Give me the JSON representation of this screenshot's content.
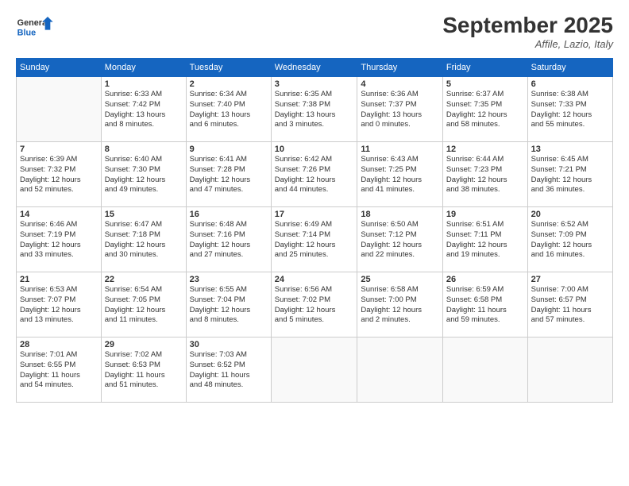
{
  "header": {
    "logo_line1": "General",
    "logo_line2": "Blue",
    "month": "September 2025",
    "location": "Affile, Lazio, Italy"
  },
  "weekdays": [
    "Sunday",
    "Monday",
    "Tuesday",
    "Wednesday",
    "Thursday",
    "Friday",
    "Saturday"
  ],
  "weeks": [
    [
      {
        "day": "",
        "info": ""
      },
      {
        "day": "1",
        "info": "Sunrise: 6:33 AM\nSunset: 7:42 PM\nDaylight: 13 hours\nand 8 minutes."
      },
      {
        "day": "2",
        "info": "Sunrise: 6:34 AM\nSunset: 7:40 PM\nDaylight: 13 hours\nand 6 minutes."
      },
      {
        "day": "3",
        "info": "Sunrise: 6:35 AM\nSunset: 7:38 PM\nDaylight: 13 hours\nand 3 minutes."
      },
      {
        "day": "4",
        "info": "Sunrise: 6:36 AM\nSunset: 7:37 PM\nDaylight: 13 hours\nand 0 minutes."
      },
      {
        "day": "5",
        "info": "Sunrise: 6:37 AM\nSunset: 7:35 PM\nDaylight: 12 hours\nand 58 minutes."
      },
      {
        "day": "6",
        "info": "Sunrise: 6:38 AM\nSunset: 7:33 PM\nDaylight: 12 hours\nand 55 minutes."
      }
    ],
    [
      {
        "day": "7",
        "info": "Sunrise: 6:39 AM\nSunset: 7:32 PM\nDaylight: 12 hours\nand 52 minutes."
      },
      {
        "day": "8",
        "info": "Sunrise: 6:40 AM\nSunset: 7:30 PM\nDaylight: 12 hours\nand 49 minutes."
      },
      {
        "day": "9",
        "info": "Sunrise: 6:41 AM\nSunset: 7:28 PM\nDaylight: 12 hours\nand 47 minutes."
      },
      {
        "day": "10",
        "info": "Sunrise: 6:42 AM\nSunset: 7:26 PM\nDaylight: 12 hours\nand 44 minutes."
      },
      {
        "day": "11",
        "info": "Sunrise: 6:43 AM\nSunset: 7:25 PM\nDaylight: 12 hours\nand 41 minutes."
      },
      {
        "day": "12",
        "info": "Sunrise: 6:44 AM\nSunset: 7:23 PM\nDaylight: 12 hours\nand 38 minutes."
      },
      {
        "day": "13",
        "info": "Sunrise: 6:45 AM\nSunset: 7:21 PM\nDaylight: 12 hours\nand 36 minutes."
      }
    ],
    [
      {
        "day": "14",
        "info": "Sunrise: 6:46 AM\nSunset: 7:19 PM\nDaylight: 12 hours\nand 33 minutes."
      },
      {
        "day": "15",
        "info": "Sunrise: 6:47 AM\nSunset: 7:18 PM\nDaylight: 12 hours\nand 30 minutes."
      },
      {
        "day": "16",
        "info": "Sunrise: 6:48 AM\nSunset: 7:16 PM\nDaylight: 12 hours\nand 27 minutes."
      },
      {
        "day": "17",
        "info": "Sunrise: 6:49 AM\nSunset: 7:14 PM\nDaylight: 12 hours\nand 25 minutes."
      },
      {
        "day": "18",
        "info": "Sunrise: 6:50 AM\nSunset: 7:12 PM\nDaylight: 12 hours\nand 22 minutes."
      },
      {
        "day": "19",
        "info": "Sunrise: 6:51 AM\nSunset: 7:11 PM\nDaylight: 12 hours\nand 19 minutes."
      },
      {
        "day": "20",
        "info": "Sunrise: 6:52 AM\nSunset: 7:09 PM\nDaylight: 12 hours\nand 16 minutes."
      }
    ],
    [
      {
        "day": "21",
        "info": "Sunrise: 6:53 AM\nSunset: 7:07 PM\nDaylight: 12 hours\nand 13 minutes."
      },
      {
        "day": "22",
        "info": "Sunrise: 6:54 AM\nSunset: 7:05 PM\nDaylight: 12 hours\nand 11 minutes."
      },
      {
        "day": "23",
        "info": "Sunrise: 6:55 AM\nSunset: 7:04 PM\nDaylight: 12 hours\nand 8 minutes."
      },
      {
        "day": "24",
        "info": "Sunrise: 6:56 AM\nSunset: 7:02 PM\nDaylight: 12 hours\nand 5 minutes."
      },
      {
        "day": "25",
        "info": "Sunrise: 6:58 AM\nSunset: 7:00 PM\nDaylight: 12 hours\nand 2 minutes."
      },
      {
        "day": "26",
        "info": "Sunrise: 6:59 AM\nSunset: 6:58 PM\nDaylight: 11 hours\nand 59 minutes."
      },
      {
        "day": "27",
        "info": "Sunrise: 7:00 AM\nSunset: 6:57 PM\nDaylight: 11 hours\nand 57 minutes."
      }
    ],
    [
      {
        "day": "28",
        "info": "Sunrise: 7:01 AM\nSunset: 6:55 PM\nDaylight: 11 hours\nand 54 minutes."
      },
      {
        "day": "29",
        "info": "Sunrise: 7:02 AM\nSunset: 6:53 PM\nDaylight: 11 hours\nand 51 minutes."
      },
      {
        "day": "30",
        "info": "Sunrise: 7:03 AM\nSunset: 6:52 PM\nDaylight: 11 hours\nand 48 minutes."
      },
      {
        "day": "",
        "info": ""
      },
      {
        "day": "",
        "info": ""
      },
      {
        "day": "",
        "info": ""
      },
      {
        "day": "",
        "info": ""
      }
    ]
  ]
}
